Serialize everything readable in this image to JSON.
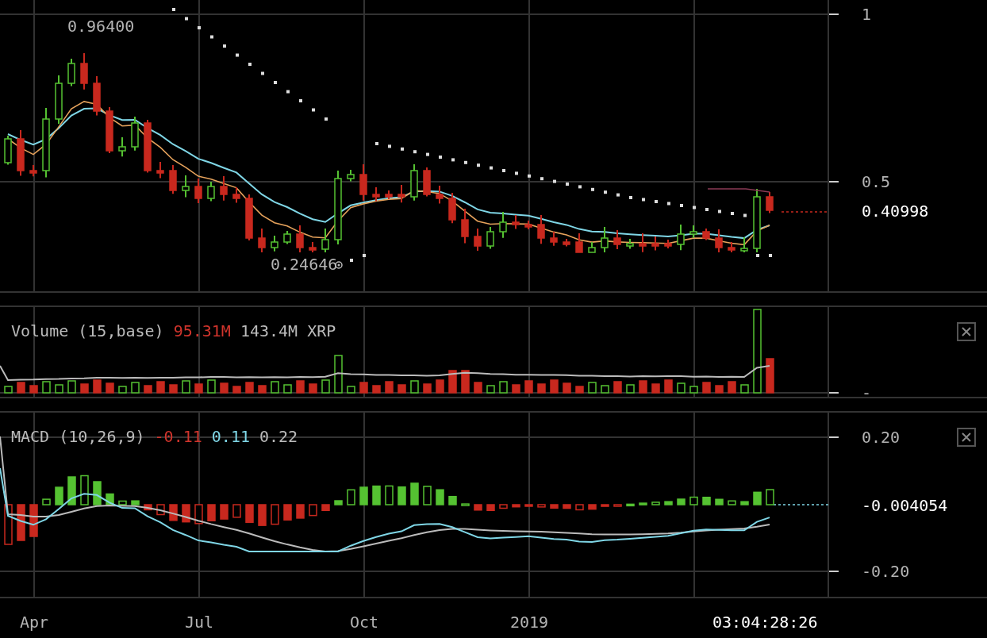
{
  "price_panel": {
    "high_label": "0.96400",
    "low_label": "0.24646",
    "axis_ticks": [
      {
        "label": "1"
      },
      {
        "label": "0.5"
      }
    ],
    "current_price": "0.40998"
  },
  "volume_panel": {
    "legend": [
      {
        "text": "Volume (15,base)",
        "color": "#bbbbbb"
      },
      {
        "text": "95.31M",
        "color": "#d0342c"
      },
      {
        "text": "143.4M XRP",
        "color": "#bbbbbb"
      }
    ],
    "axis_ticks": [
      {
        "label": "-"
      }
    ]
  },
  "macd_panel": {
    "legend": [
      {
        "text": "MACD (10,26,9)",
        "color": "#bbbbbb"
      },
      {
        "text": "-0.11",
        "color": "#d0342c"
      },
      {
        "text": "0.11",
        "color": "#7fd6e6"
      },
      {
        "text": "0.22",
        "color": "#bbbbbb"
      }
    ],
    "axis_ticks": [
      {
        "label": "0.20"
      },
      {
        "label": "-0.20"
      }
    ],
    "current_value": "-0.004054"
  },
  "time_axis": {
    "labels": [
      "Apr",
      "Jul",
      "Oct",
      "2019"
    ],
    "countdown": "03:04:28:26"
  }
}
